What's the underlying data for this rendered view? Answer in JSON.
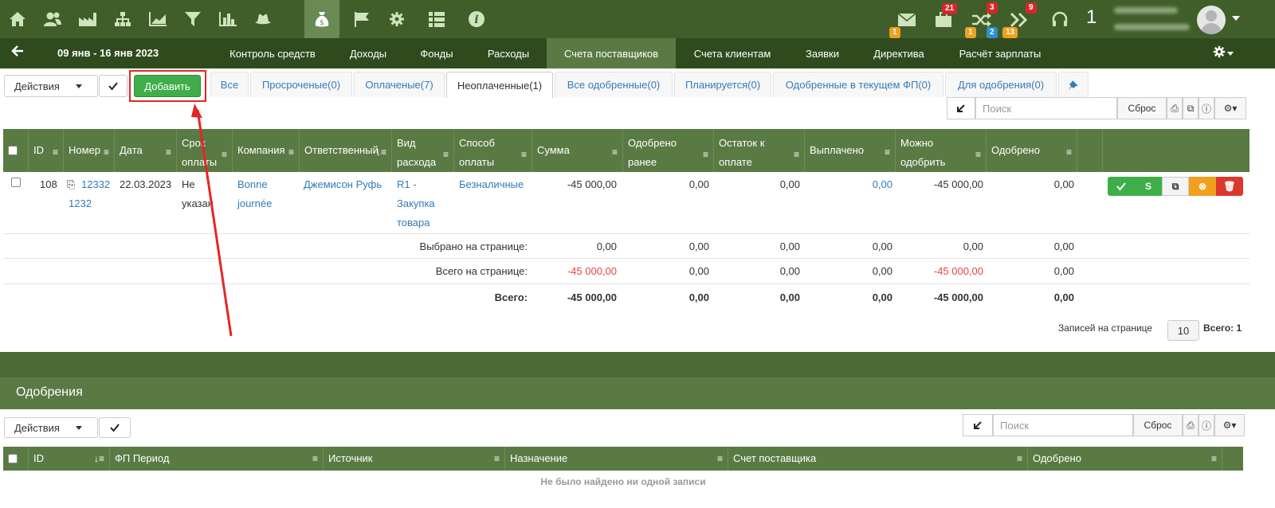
{
  "topbar": {
    "badges": {
      "mail": "1",
      "briefcase": "21",
      "shuffle_red": "3",
      "shuffle_orange": "1",
      "shuffle_blue": "2",
      "forward_red": "9",
      "forward_orange": "13"
    },
    "user_number": "1"
  },
  "nav": {
    "daterange": "09 янв - 16 янв 2023",
    "items": [
      "Контроль средств",
      "Доходы",
      "Фонды",
      "Расходы",
      "Счета поставщиков",
      "Счета клиентам",
      "Заявки",
      "Директива",
      "Расчёт зарплаты"
    ]
  },
  "toolbar": {
    "actions_label": "Действия",
    "add_label": "Добавить",
    "search_placeholder": "Поиск",
    "reset_label": "Сброс"
  },
  "tabs": [
    "Все",
    "Просроченые(0)",
    "Оплаченые(7)",
    "Неоплаченные(1)",
    "Все одобренные(0)",
    "Планируется(0)",
    "Одобренные в текущем ФП(0)",
    "Для одобрения(0)"
  ],
  "table": {
    "columns": [
      "ID",
      "Номер",
      "Дата",
      "Срок оплаты",
      "Компания",
      "Ответственный",
      "Вид расхода",
      "Способ оплаты",
      "Сумма",
      "Одобрено ранее",
      "Остаток к оплате",
      "Выплачено",
      "Можно одобрить",
      "Одобрено"
    ],
    "row": {
      "id": "108",
      "number_1": "12332",
      "number_2": "1232",
      "date": "22.03.2023",
      "due_1": "Не",
      "due_2": "указан",
      "company_1": "Bonne",
      "company_2": "journée",
      "responsible": "Джемисон Руфь",
      "expense_1": "R1 -",
      "expense_2": "Закупка",
      "expense_3": "товара",
      "payment": "Безналичные",
      "sum": "-45 000,00",
      "approved_before": "0,00",
      "remaining": "0,00",
      "paid": "0,00",
      "can_approve": "-45 000,00",
      "approved": "0,00"
    },
    "selected": {
      "label": "Выбрано на странице:",
      "sum": "0,00",
      "approved_before": "0,00",
      "remaining": "0,00",
      "paid": "0,00",
      "can_approve": "0,00",
      "approved": "0,00"
    },
    "page_total": {
      "label": "Всего на странице:",
      "sum": "-45 000,00",
      "approved_before": "0,00",
      "remaining": "0,00",
      "paid": "0,00",
      "can_approve": "-45 000,00",
      "approved": "0,00"
    },
    "grand_total": {
      "label": "Всего:",
      "sum": "-45 000,00",
      "approved_before": "0,00",
      "remaining": "0,00",
      "paid": "0,00",
      "can_approve": "-45 000,00",
      "approved": "0,00"
    },
    "per_page_label": "Записей на странице",
    "per_page_value": "10",
    "total_label": "Всего: 1"
  },
  "approvals": {
    "title": "Одобрения",
    "columns": [
      "ID",
      "ФП Период",
      "Источник",
      "Назначение",
      "Счет поставщика",
      "Одобрено"
    ],
    "empty": "Не было найдено ни одной записи"
  }
}
